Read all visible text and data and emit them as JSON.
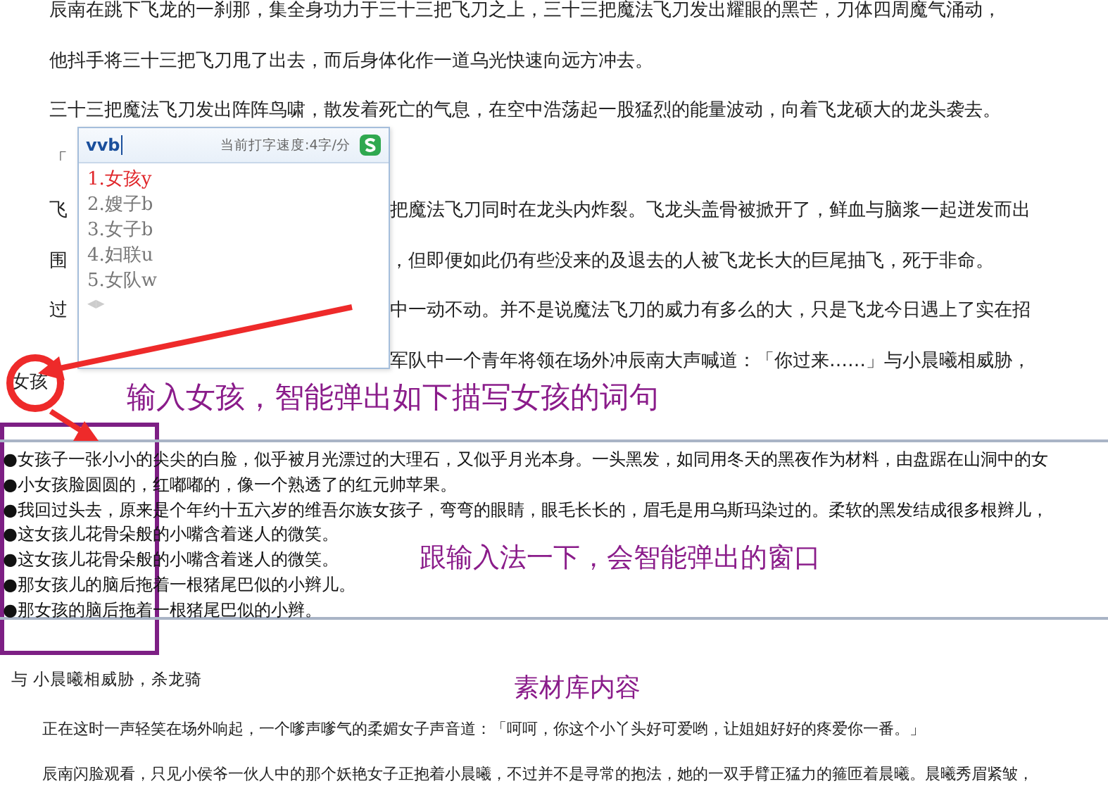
{
  "document": {
    "lines": [
      {
        "left": "辰南在跳下飞龙的一刹那，集全身功力于三十三把飞刀之上，三十三把魔法飞刀发出耀眼的黑芒，刀体四周魔气涌动，"
      },
      {
        "left": "他抖手将三十三把飞刀甩了出去，而后身体化作一道乌光快速向远方冲去。"
      },
      {
        "left": "三十三把魔法飞刀发出阵阵鸟啸，散发着死亡的气息，在空中浩荡起一股猛烈的能量波动，向着飞龙硕大的龙头袭去。"
      },
      {
        "left": "「"
      },
      {
        "left": "飞",
        "right": "把魔法飞刀同时在龙头内炸裂。飞龙头盖骨被掀开了，鲜血与脑浆一起迸发而出"
      },
      {
        "left": "围",
        "right": "，但即便如此仍有些没来的及退去的人被飞龙长大的巨尾抽飞，死于非命。"
      },
      {
        "left": "过",
        "right": "中一动不动。并不是说魔法飞刀的威力有多么的大，只是飞龙今日遇上了实在招"
      },
      {
        "right": "军队中一个青年将领在场外冲辰南大声喊道：「你过来……」与小晨曦相威胁，"
      }
    ],
    "typed_word": "女孩"
  },
  "ime_popup": {
    "input": "vvb",
    "speed": "当前打字速度:4字/分",
    "candidates": [
      {
        "text": "1.女孩y",
        "selected": true
      },
      {
        "text": "2.嫂子b",
        "selected": false
      },
      {
        "text": "3.女子b",
        "selected": false
      },
      {
        "text": "4.妇联u",
        "selected": false
      },
      {
        "text": "5.女队w",
        "selected": false
      }
    ],
    "pager": "◀▶"
  },
  "annotations": [
    "输入女孩，智能弹出如下描写女孩的词句",
    "跟输入法一下，会智能弹出的窗口",
    "素材库内容"
  ],
  "material_panel": {
    "items": [
      "●女孩子一张小小的尖尖的白脸，似乎被月光漂过的大理石，又似乎月光本身。一头黑发，如同用冬天的黑夜作为材料，由盘踞在山洞中的女",
      "●小女孩脸圆圆的，红嘟嘟的，像一个熟透了的红元帅苹果。",
      "●我回过头去，原来是个年约十五六岁的维吾尔族女孩子，弯弯的眼睛，眼毛长长的，眉毛是用乌斯玛染过的。柔软的黑发结成很多根辫儿，",
      "●这女孩儿花骨朵般的小嘴含着迷人的微笑。",
      "●这女孩儿花骨朵般的小嘴含着迷人的微笑。",
      "●那女孩儿的脑后拖着一根猪尾巴似的小辫儿。",
      "●那女孩的脑后拖着一根猪尾巴似的小辫。"
    ]
  },
  "lower_document": {
    "heading": "与 小晨曦相威胁，杀龙骑",
    "paragraphs": [
      "正在这时一声轻笑在场外响起，一个嗲声嗲气的柔媚女子声音道：「呵呵，你这个小丫头好可爱哟，让姐姐好好的疼爱你一番。」",
      "辰南闪脸观看，只见小侯爷一伙人中的那个妖艳女子正抱着小晨曦，不过并不是寻常的抱法，她的一双手臂正猛力的箍匝着晨曦。晨曦秀眉紧皱，"
    ]
  }
}
